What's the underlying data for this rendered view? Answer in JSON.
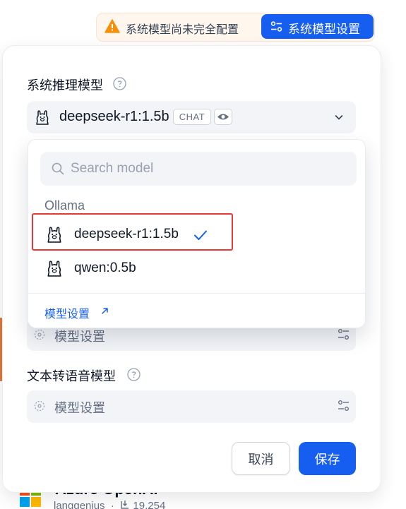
{
  "warning": {
    "text": "系统模型尚未完全配置",
    "button_label": "系统模型设置",
    "icon": "warning-triangle-icon",
    "accent": "#f79009"
  },
  "reasoning_model": {
    "label": "系统推理模型",
    "selected_model": "deepseek-r1:1.5b",
    "badge_chat": "CHAT",
    "badge_vision_icon": "eye-icon"
  },
  "dropdown": {
    "search_placeholder": "Search model",
    "provider_group": "Ollama",
    "options": [
      {
        "name": "deepseek-r1:1.5b",
        "selected": true
      },
      {
        "name": "qwen:0.5b",
        "selected": false
      }
    ],
    "footer_link": "模型设置"
  },
  "hidden_section": {
    "placeholder": "模型设置"
  },
  "tts_model": {
    "label": "文本转语音模型",
    "placeholder": "模型设置"
  },
  "footer": {
    "cancel_label": "取消",
    "save_label": "保存"
  },
  "background": {
    "card_title": "Azure OpenAI",
    "card_author": "langgenius",
    "card_installs": "19,254"
  },
  "colors": {
    "primary": "#155eef",
    "warning_bg": "#fff7ed",
    "highlight_border": "#e53935",
    "field_bg": "#f2f4f7"
  }
}
